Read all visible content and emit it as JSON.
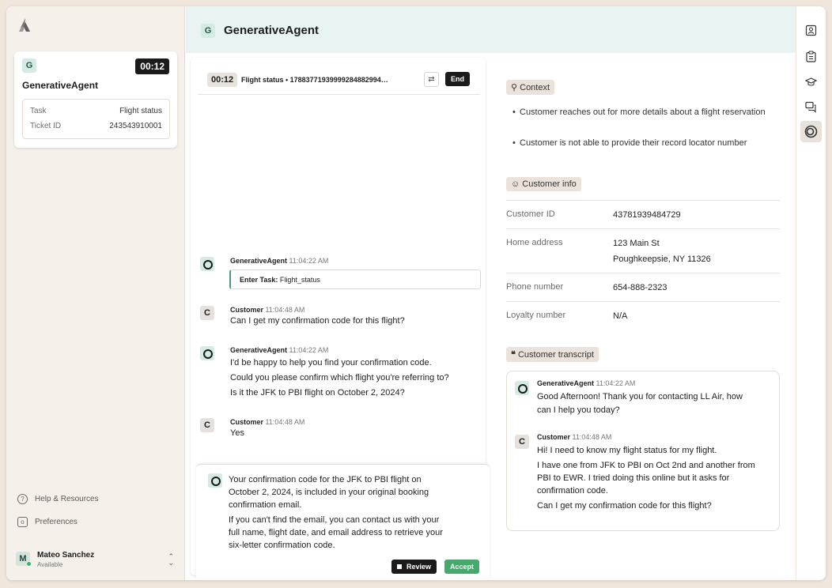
{
  "sidebar": {
    "card": {
      "badge": "G",
      "timer": "00:12",
      "title": "GenerativeAgent",
      "rows": [
        {
          "key": "Task",
          "value": "Flight status"
        },
        {
          "key": "Ticket ID",
          "value": "243543910001"
        }
      ]
    },
    "links": [
      {
        "icon": "question-icon",
        "label": "Help & Resources"
      },
      {
        "icon": "gear-icon",
        "label": "Preferences"
      }
    ],
    "user": {
      "initial": "M",
      "name": "Mateo Sanchez",
      "status": "Available"
    }
  },
  "header": {
    "badge": "G",
    "title": "GenerativeAgent"
  },
  "conversation": {
    "timer": "00:12",
    "ticket": "Flight status • 17883771939999284882994…",
    "end_label": "End",
    "messages": [
      {
        "sender": "GenerativeAgent",
        "time": "11:04:22 AM",
        "task_label": "Enter Task:",
        "task_value": "Flight_status"
      },
      {
        "sender": "Customer",
        "initial": "C",
        "time": "11:04:48 AM",
        "lines": [
          "Can I get my confirmation code for this flight?"
        ]
      },
      {
        "sender": "GenerativeAgent",
        "time": "11:04:22 AM",
        "lines": [
          "I'd be happy to help you find your confirmation code.",
          "Could you please confirm which flight you're referring to?",
          "Is it the JFK to PBI flight on October 2, 2024?"
        ]
      },
      {
        "sender": "Customer",
        "initial": "C",
        "time": "11:04:48 AM",
        "lines": [
          "Yes"
        ]
      }
    ],
    "suggestion": {
      "lines": [
        "Your confirmation code for the JFK to PBI flight on",
        "October 2, 2024, is included in your original booking",
        "confirmation email.",
        "If you can't find the email, you can contact us with your",
        "full name, flight date, and email address to retrieve your",
        "six-letter confirmation code."
      ],
      "review_label": "Review",
      "accept_label": "Accept"
    }
  },
  "context": {
    "title": "Context",
    "bullets": [
      "Customer reaches out for more details about a flight reservation",
      "Customer is not able to provide their record locator number"
    ]
  },
  "customer_info": {
    "title": "Customer info",
    "rows": [
      {
        "key": "Customer ID",
        "value": "43781939484729"
      },
      {
        "key": "Home address",
        "value": "123 Main St",
        "value2": "Poughkeepsie, NY 11326"
      },
      {
        "key": "Phone number",
        "value": "654-888-2323"
      },
      {
        "key": "Loyalty number",
        "value": "N/A"
      }
    ]
  },
  "transcript": {
    "title": "Customer transcript",
    "messages": [
      {
        "sender": "GenerativeAgent",
        "time": "11:04:22 AM",
        "lines": [
          "Good Afternoon! Thank you for contacting LL Air, how",
          "can I help you today?"
        ]
      },
      {
        "sender": "Customer",
        "initial": "C",
        "time": "11:04:48 AM",
        "lines": [
          "Hi! I need to know my flight status for my flight.",
          "I have one from JFK to PBI on Oct 2nd and another from",
          "PBI to EWR. I tried doing this online but it asks for",
          "confirmation code.",
          "Can I get my confirmation code for this flight?"
        ]
      }
    ]
  },
  "rail": [
    "contact-card-icon",
    "clipboard-icon",
    "graduation-cap-icon",
    "chat-bubbles-icon",
    "agent-logo-icon"
  ]
}
